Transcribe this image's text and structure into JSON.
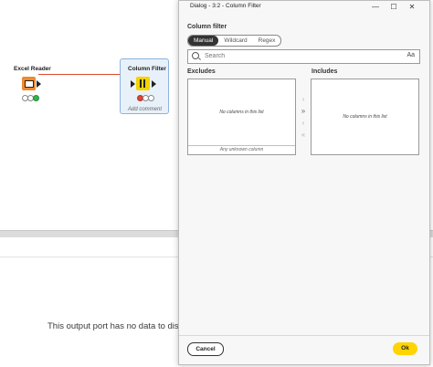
{
  "workflow": {
    "nodes": [
      {
        "label": "Excel Reader",
        "icon": "excel-reader-icon",
        "color": "#f08a2c"
      },
      {
        "label": "Column Filter",
        "icon": "column-filter-icon",
        "color": "#f5d200"
      }
    ],
    "add_comment": "Add comment",
    "connection_color": "#e0462f"
  },
  "output_panel": {
    "message": "This output port has no data to display"
  },
  "dialog": {
    "title": "Dialog - 3:2 - Column Filter",
    "window_controls": {
      "minimize": "—",
      "maximize": "☐",
      "close": "✕"
    },
    "section_title": "Column filter",
    "modes": [
      "Manual",
      "Wildcard",
      "Regex"
    ],
    "active_mode": "Manual",
    "search": {
      "placeholder": "Search",
      "case_toggle": "Aa"
    },
    "excludes": {
      "label": "Excludes",
      "empty_text": "No columns in this list",
      "unknown_column": "Any unknown column"
    },
    "includes": {
      "label": "Includes",
      "empty_text": "No columns in this list"
    },
    "move_buttons": [
      "›",
      "»",
      "‹",
      "«"
    ],
    "cancel_label": "Cancel",
    "ok_label": "Ok",
    "accent_color": "#ffd400"
  }
}
